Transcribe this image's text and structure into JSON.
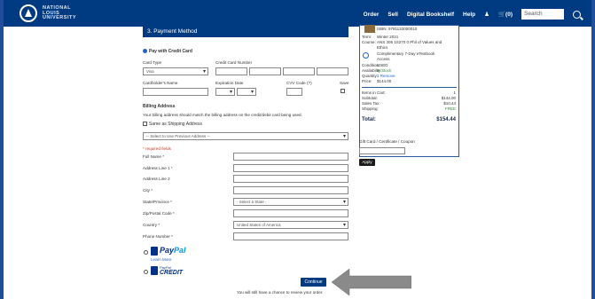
{
  "header": {
    "brand_line1": "NATIONAL",
    "brand_line2": "LOUIS",
    "brand_line3": "UNIVERSITY",
    "nav": [
      "Order",
      "Sell",
      "Digital Bookshelf",
      "Help"
    ],
    "cart_label": "(0)",
    "search_placeholder": "Search"
  },
  "form": {
    "section_title": "3. Payment Method",
    "pay_credit_label": "Pay with Credit Card",
    "card_type_label": "Card Type",
    "card_type_value": "Visa",
    "card_number_label": "Credit Card Number",
    "cardholder_label": "Cardholder's Name",
    "expiration_label": "Expiration Date",
    "cvv_label": "CVV Code (?)",
    "save_label": "Save",
    "billing_title": "Billing Address",
    "billing_note": "Your billing address should match the billing address on the credit/debit card being used.",
    "same_as_shipping": "Same as Shipping Address",
    "prev_address": "-- Select to Use Previous Address --",
    "required_note": "* required fields",
    "full_name": "Full Name *",
    "address1": "Address Line 1 *",
    "address2": "Address Line 2",
    "city": "City *",
    "state": "State/Province *",
    "state_value": "- Select a State -",
    "zip": "Zip/Postal Code *",
    "country": "Country *",
    "country_value": "United States of America",
    "phone": "Phone Number *",
    "paypal_pay": "Pay",
    "paypal_pal": "Pal",
    "paypal_learn": "Learn More",
    "paypal_credit_top": "PayPal",
    "paypal_credit_bottom": "CREDIT",
    "continue_label": "Continue",
    "review_note": "You will still have a chance to review your order."
  },
  "summary": {
    "isbn": "ISBN: 9781133000010",
    "term_label": "Term:",
    "term_value": "Winter 2021",
    "course_label": "Course:",
    "course_value1": "ANS 305 1S270 0 Phil of Values and",
    "course_value2": "Ethics",
    "access1": "Complimentary 7-Day eTextbook",
    "access2": "Access",
    "condition_label": "Condition:",
    "condition_value": "USED",
    "availability_label": "Availability:",
    "availability_value": "In Stock",
    "quantity_label": "Quantity:",
    "quantity_value": "1 Remove",
    "price_label": "Price:",
    "price_value": "$144.00",
    "items_label": "Items in Cart:",
    "items_value": "1",
    "subtotal_label": "Subtotal:",
    "subtotal_value": "$144.00",
    "tax_label": "Sales Tax:",
    "tax_value": "$10.44",
    "shipping_label": "Shipping:",
    "shipping_value": "FREE",
    "total_label": "Total:",
    "total_value": "$154.44",
    "gift_label": "Gift Card / Certificate / Coupon",
    "apply_label": "Apply"
  }
}
